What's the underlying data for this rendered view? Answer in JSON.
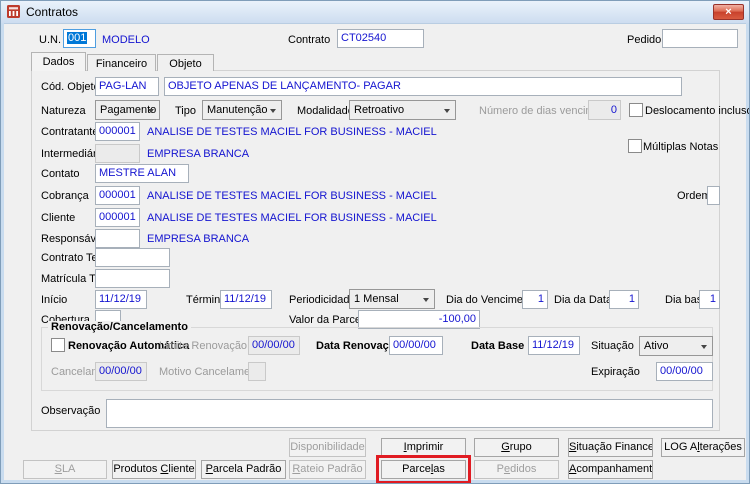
{
  "window": {
    "title": "Contratos",
    "close": "×"
  },
  "header": {
    "un_label": "U.N.",
    "un_value": "001",
    "un_text": "MODELO",
    "contrato_label": "Contrato",
    "contrato_value": "CT02540",
    "pedido_label": "Pedido",
    "pedido_value": ""
  },
  "tabs": {
    "dados": {
      "label": "Dados"
    },
    "financeiro": {
      "label": "Financeiro"
    },
    "objeto": {
      "label": "Objeto"
    }
  },
  "main": {
    "cod_objeto": {
      "label": "Cód. Objeto",
      "code": "PAG-LAN",
      "desc": "OBJETO APENAS DE LANÇAMENTO- PAGAR"
    },
    "natureza": {
      "label": "Natureza",
      "value": "Pagamento"
    },
    "tipo": {
      "label": "Tipo",
      "value": "Manutenção"
    },
    "modalidade": {
      "label": "Modalidade",
      "value": "Retroativo"
    },
    "dias_vencimento": {
      "label": "Número de dias vencimento",
      "value": "0"
    },
    "deslocamento": {
      "label": "Deslocamento incluso",
      "checked": false
    },
    "contratante": {
      "label": "Contratante",
      "code": "000001",
      "name": "ANALISE DE TESTES MACIEL FOR BUSINESS - MACIEL"
    },
    "intermediaria": {
      "label": "Intermediária",
      "code": "",
      "name": "EMPRESA BRANCA"
    },
    "multiplas_notas": {
      "label": "Múltiplas Notas",
      "checked": false
    },
    "contato": {
      "label": "Contato",
      "value": "MESTRE ALAN"
    },
    "cobranca": {
      "label": "Cobrança",
      "code": "000001",
      "name": "ANALISE DE TESTES MACIEL FOR BUSINESS - MACIEL"
    },
    "ordem": {
      "label": "Ordem",
      "value": ""
    },
    "cliente": {
      "label": "Cliente",
      "code": "000001",
      "name": "ANALISE DE TESTES MACIEL FOR BUSINESS - MACIEL"
    },
    "responsavel": {
      "label": "Responsável",
      "code": "",
      "name": "EMPRESA BRANCA"
    },
    "contrato_terceiro": {
      "label": "Contrato Terceiro",
      "value": ""
    },
    "matricula_terceiro": {
      "label": "Matrícula Terceiro",
      "value": ""
    },
    "inicio": {
      "label": "Início",
      "value": "11/12/19"
    },
    "termino": {
      "label": "Término",
      "value": "11/12/19"
    },
    "periodicidade": {
      "label": "Periodicidade",
      "value": "1 Mensal"
    },
    "dia_vencimento": {
      "label": "Dia do Vencimento",
      "value": "1"
    },
    "dia_data": {
      "label": "Dia da Data",
      "value": "1"
    },
    "dia_base": {
      "label": "Dia base",
      "value": "1"
    },
    "cobertura": {
      "label": "Cobertura",
      "value": ""
    },
    "valor_parcela": {
      "label": "Valor da Parcela",
      "value": "-100,00"
    },
    "observacao": {
      "label": "Observação",
      "value": ""
    }
  },
  "renovacao": {
    "title": "Renovação/Cancelamento",
    "renovacao_automatica": {
      "label": "Renovação Automática",
      "checked": false
    },
    "limite_renovacao": {
      "label": "Limite Renovação",
      "value": "00/00/00"
    },
    "data_renovacao": {
      "label": "Data Renovação",
      "value": "00/00/00"
    },
    "data_base": {
      "label": "Data Base",
      "value": "11/12/19"
    },
    "situacao": {
      "label": "Situação",
      "value": "Ativo"
    },
    "cancelamento": {
      "label": "Cancelamento",
      "value": "00/00/00"
    },
    "motivo_cancelamento": {
      "label": "Motivo Cancelamento",
      "value": ""
    },
    "expiracao": {
      "label": "Expiração",
      "value": "00/00/00"
    }
  },
  "buttons": {
    "disponibilidade": {
      "pre": "Disponibilidade",
      "key": "",
      "post": "",
      "disabled": true
    },
    "imprimir": {
      "pre": "",
      "key": "I",
      "post": "mprimir",
      "disabled": false
    },
    "grupo": {
      "pre": "",
      "key": "G",
      "post": "rupo",
      "disabled": false
    },
    "situacao_financeira": {
      "pre": "",
      "key": "S",
      "post": "ituação Financeira",
      "disabled": false
    },
    "log_alteracoes": {
      "pre": "LOG A",
      "key": "l",
      "post": "terações",
      "disabled": false
    },
    "sla": {
      "pre": "",
      "key": "S",
      "post": "LA",
      "disabled": true
    },
    "produtos_cliente": {
      "pre": "Produtos ",
      "key": "C",
      "post": "liente",
      "disabled": false
    },
    "parcela_padrao": {
      "pre": "",
      "key": "P",
      "post": "arcela Padrão",
      "disabled": false
    },
    "rateio_padrao": {
      "pre": "",
      "key": "R",
      "post": "ateio Padrão",
      "disabled": true
    },
    "parcelas": {
      "pre": "Parce",
      "key": "l",
      "post": "as",
      "disabled": false
    },
    "pedidos": {
      "pre": "P",
      "key": "e",
      "post": "didos",
      "disabled": true
    },
    "acompanhamento": {
      "pre": "",
      "key": "A",
      "post": "companhamento",
      "disabled": false
    }
  },
  "colors": {
    "value_blue": "#1414d0",
    "selection_blue": "#0078d7",
    "annotation_red": "#e01b22",
    "close_red": "#c8402c"
  }
}
